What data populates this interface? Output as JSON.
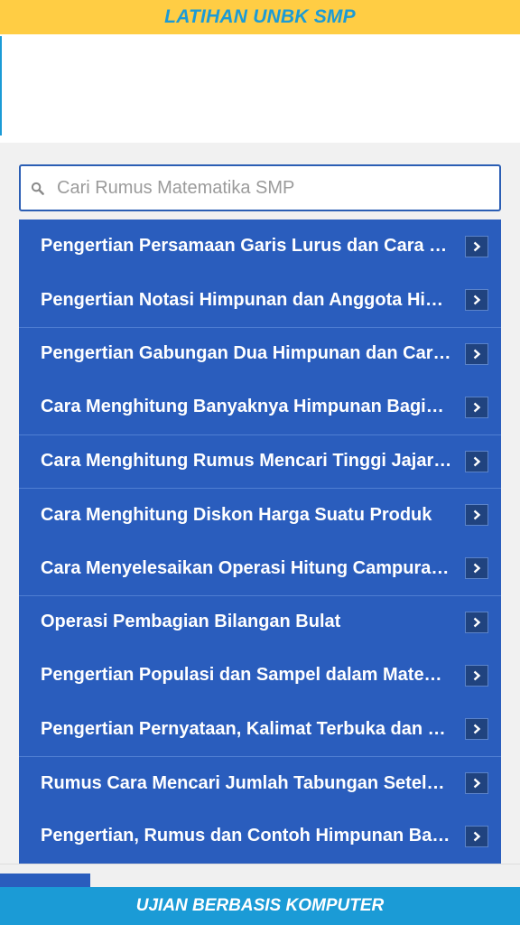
{
  "header": {
    "title": "LATIHAN UNBK SMP"
  },
  "search": {
    "placeholder": "Cari Rumus Matematika SMP",
    "icon": "search-icon"
  },
  "list": {
    "items": [
      {
        "label": "Pengertian Persamaan Garis Lurus dan Cara …"
      },
      {
        "label": "Pengertian Notasi Himpunan dan Anggota Hi…"
      },
      {
        "label": "Pengertian Gabungan Dua Himpunan dan Car…"
      },
      {
        "label": "Cara Menghitung Banyaknya Himpunan Bagi…"
      },
      {
        "label": "Cara Menghitung Rumus Mencari Tinggi Jajar …"
      },
      {
        "label": "Cara Menghitung Diskon Harga Suatu Produk"
      },
      {
        "label": "Cara Menyelesaikan Operasi Hitung Campura…"
      },
      {
        "label": "Operasi Pembagian Bilangan Bulat"
      },
      {
        "label": "Pengertian Populasi dan Sampel dalam Mate…"
      },
      {
        "label": "Pengertian Pernyataan, Kalimat Terbuka dan …"
      },
      {
        "label": "Rumus Cara Mencari Jumlah Tabungan Setela…"
      },
      {
        "label": "Pengertian, Rumus dan Contoh Himpunan Ba…"
      }
    ]
  },
  "footer": {
    "text": "UJIAN BERBASIS KOMPUTER"
  },
  "colors": {
    "header_bg": "#ffcd44",
    "title": "#1b9bd6",
    "list_bg": "#2a5dbd",
    "footer_bg": "#1b9bd6"
  }
}
